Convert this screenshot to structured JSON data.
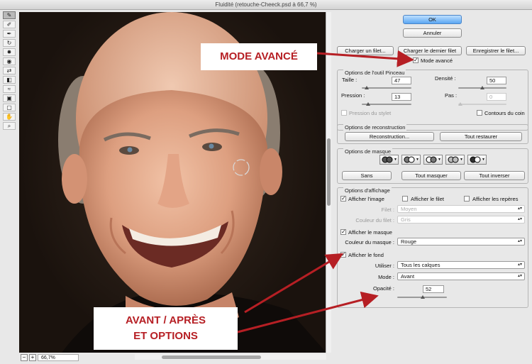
{
  "window": {
    "title": "Fluidité (retouche-Cheeck.psd à 66,7 %)"
  },
  "tools": [
    "warp-tool",
    "reconstruct-tool",
    "smooth-tool",
    "twirl-tool",
    "pucker-tool",
    "bloat-tool",
    "push-left-tool",
    "mirror-tool",
    "turbulence-tool",
    "freeze-mask-tool",
    "thaw-mask-tool",
    "hand-tool",
    "zoom-tool"
  ],
  "status": {
    "zoom_out": "−",
    "zoom_in": "+",
    "zoom": "66,7%"
  },
  "panel": {
    "ok": "OK",
    "cancel": "Annuler",
    "load_mesh": "Charger un filet...",
    "load_last_mesh": "Charger le dernier filet",
    "save_mesh": "Enregistrer le filet...",
    "advanced_mode": {
      "label": "Mode avancé",
      "checked": true
    },
    "brush": {
      "title": "Options de l'outil Pinceau",
      "size": {
        "label": "Taille :",
        "value": "47",
        "level": 0.1
      },
      "density": {
        "label": "Densité :",
        "value": "50",
        "level": 0.5
      },
      "pressure": {
        "label": "Pression :",
        "value": "13",
        "level": 0.13
      },
      "rate": {
        "label": "Pas :",
        "value": "0",
        "level": 0
      },
      "stylus": {
        "label": "Pression du stylet",
        "checked": false
      },
      "pin_edges": {
        "label": "Contours du coin",
        "checked": false
      }
    },
    "reconstruct": {
      "title": "Options de reconstruction",
      "reconstruct": "Reconstruction...",
      "restore_all": "Tout restaurer"
    },
    "mask": {
      "title": "Options de masque",
      "none": "Sans",
      "mask_all": "Tout masquer",
      "invert_all": "Tout inverser"
    },
    "view": {
      "title": "Options d'affichage",
      "show_image": {
        "label": "Afficher l'image",
        "checked": true
      },
      "show_mesh": {
        "label": "Afficher le filet",
        "checked": false
      },
      "show_guides": {
        "label": "Afficher les repères",
        "checked": false
      },
      "mesh_size": {
        "label": "Filet :",
        "value": "Moyen"
      },
      "mesh_color": {
        "label": "Couleur du filet :",
        "value": "Gris"
      },
      "show_mask": {
        "label": "Afficher le masque",
        "checked": true
      },
      "mask_color": {
        "label": "Couleur du masque :",
        "value": "Rouge"
      },
      "show_backdrop": {
        "label": "Afficher le fond",
        "checked": true
      },
      "use": {
        "label": "Utiliser :",
        "value": "Tous les calques"
      },
      "mode": {
        "label": "Mode :",
        "value": "Avant"
      },
      "opacity": {
        "label": "Opacité :",
        "value": "52",
        "level": 0.52
      }
    }
  },
  "annotations": {
    "advanced": "MODE AVANCÉ",
    "before_after_line1": "AVANT / APRÈS",
    "before_after_line2": "ET OPTIONS"
  },
  "colors": {
    "annotation_text": "#b61f24",
    "arrow": "#b61f24",
    "ok_button": "#5aa6f2"
  }
}
